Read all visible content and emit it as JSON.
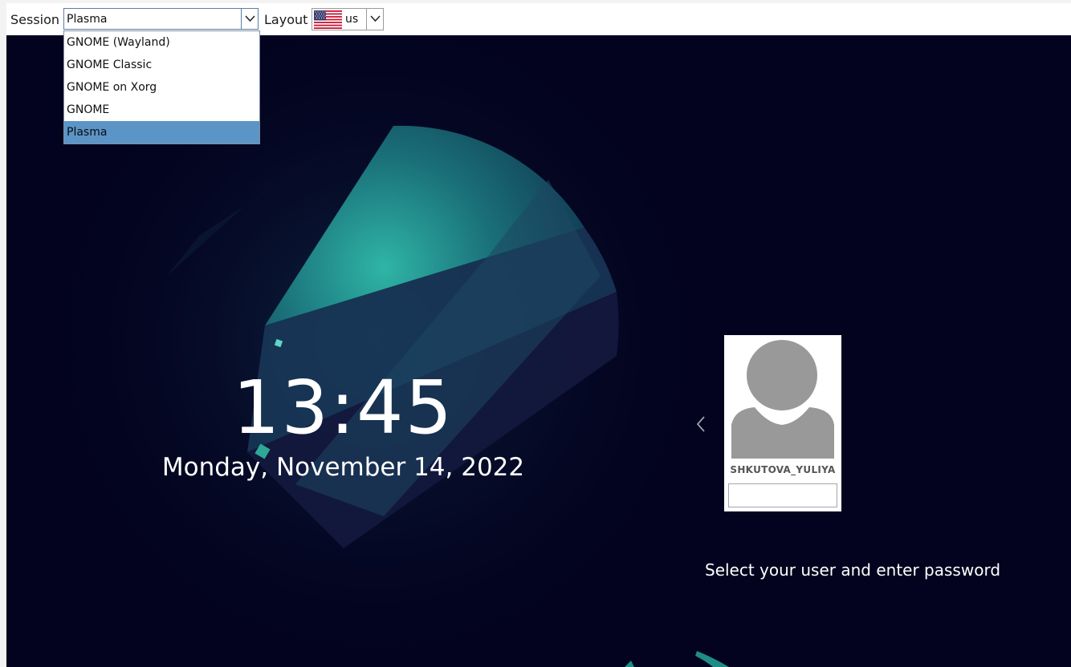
{
  "session": {
    "label": "Session",
    "value": "Plasma",
    "options": [
      "GNOME (Wayland)",
      "GNOME Classic",
      "GNOME on Xorg",
      "GNOME",
      "Plasma"
    ]
  },
  "layout": {
    "label": "Layout",
    "value": "us",
    "flag_icon": "us-flag-icon"
  },
  "clock": {
    "time": "13:45",
    "date": "Monday, November 14, 2022"
  },
  "user": {
    "name": "SHKUTOVA_YULIYA",
    "password": ""
  },
  "hint": "Select your user and enter password",
  "colors": {
    "background": "#03031f",
    "accent_teal": "#2bb3a3",
    "selection": "#5b95c8"
  }
}
